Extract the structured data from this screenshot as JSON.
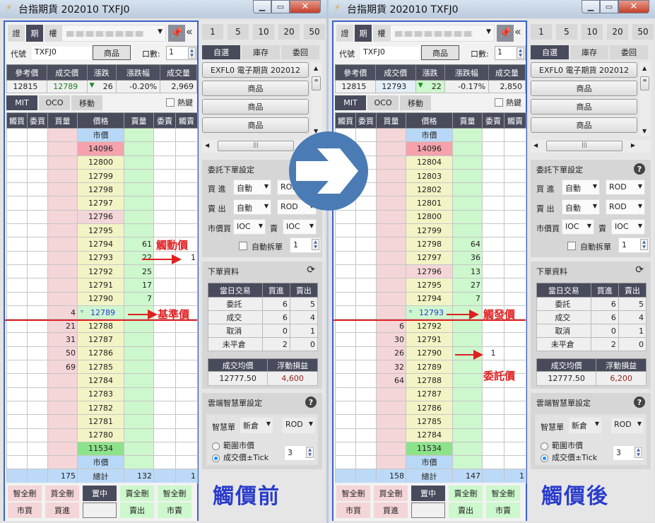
{
  "windows": {
    "before": {
      "title": "台指期貨 202010 TXFJ0",
      "segments": [
        "證",
        "期",
        "權"
      ],
      "active_segment": "期",
      "code_label": "代號",
      "code_value": "TXFJ0",
      "product_button": "商品",
      "qty_label": "口數:",
      "qty_value": "1",
      "quote_headers": [
        "參考價",
        "成交價",
        "漲跌",
        "漲跌幅",
        "成交量"
      ],
      "quote_values": {
        "ref": "12815",
        "last": "12789",
        "change": "26",
        "change_pct": "-0.20%",
        "volume": "2,969"
      },
      "tabs": [
        "MIT",
        "OCO",
        "移動"
      ],
      "hotkey_label": "熱鍵",
      "ladder_headers": [
        "觸買",
        "委買",
        "買量",
        "價格",
        "賣量",
        "委賣",
        "觸賣"
      ],
      "ladder_rows": [
        {
          "bq": "",
          "px": "市價",
          "sq": "",
          "ss": "",
          "ts": "",
          "kind": "mkt"
        },
        {
          "bq": "",
          "px": "14096",
          "sq": "",
          "ss": "",
          "ts": "",
          "kind": "up"
        },
        {
          "bq": "",
          "px": "12800",
          "sq": "",
          "ss": "",
          "ts": "",
          "kind": ""
        },
        {
          "bq": "",
          "px": "12799",
          "sq": "",
          "ss": "",
          "ts": "",
          "kind": ""
        },
        {
          "bq": "",
          "px": "12798",
          "sq": "",
          "ss": "",
          "ts": "",
          "kind": ""
        },
        {
          "bq": "",
          "px": "12797",
          "sq": "",
          "ss": "",
          "ts": "",
          "kind": ""
        },
        {
          "bq": "",
          "px": "12796",
          "sq": "",
          "ss": "",
          "ts": "",
          "kind": "pink"
        },
        {
          "bq": "",
          "px": "12795",
          "sq": "",
          "ss": "",
          "ts": "",
          "kind": ""
        },
        {
          "bq": "",
          "px": "12794",
          "sq": "61",
          "ss": "",
          "ts": "",
          "kind": ""
        },
        {
          "bq": "",
          "px": "12793",
          "sq": "22",
          "ss": "",
          "ts": "1",
          "kind": ""
        },
        {
          "bq": "",
          "px": "12792",
          "sq": "25",
          "ss": "",
          "ts": "",
          "kind": ""
        },
        {
          "bq": "",
          "px": "12791",
          "sq": "17",
          "ss": "",
          "ts": "",
          "kind": ""
        },
        {
          "bq": "",
          "px": "12790",
          "sq": "7",
          "ss": "",
          "ts": "",
          "kind": ""
        },
        {
          "bq": "4",
          "px": "12789",
          "sq": "",
          "ss": "",
          "ts": "",
          "kind": "cur"
        },
        {
          "bq": "21",
          "px": "12788",
          "sq": "",
          "ss": "",
          "ts": "",
          "kind": ""
        },
        {
          "bq": "31",
          "px": "12787",
          "sq": "",
          "ss": "",
          "ts": "",
          "kind": ""
        },
        {
          "bq": "50",
          "px": "12786",
          "sq": "",
          "ss": "",
          "ts": "",
          "kind": ""
        },
        {
          "bq": "69",
          "px": "12785",
          "sq": "",
          "ss": "",
          "ts": "",
          "kind": ""
        },
        {
          "bq": "",
          "px": "12784",
          "sq": "",
          "ss": "",
          "ts": "",
          "kind": ""
        },
        {
          "bq": "",
          "px": "12783",
          "sq": "",
          "ss": "",
          "ts": "",
          "kind": ""
        },
        {
          "bq": "",
          "px": "12782",
          "sq": "",
          "ss": "",
          "ts": "",
          "kind": ""
        },
        {
          "bq": "",
          "px": "12781",
          "sq": "",
          "ss": "",
          "ts": "",
          "kind": ""
        },
        {
          "bq": "",
          "px": "12780",
          "sq": "",
          "ss": "",
          "ts": "",
          "kind": ""
        },
        {
          "bq": "",
          "px": "11534",
          "sq": "",
          "ss": "",
          "ts": "",
          "kind": "dn"
        },
        {
          "bq": "",
          "px": "市價",
          "sq": "",
          "ss": "",
          "ts": "",
          "kind": "mkt"
        }
      ],
      "totals": {
        "bq": "175",
        "label": "總計",
        "sq": "132",
        "ts": "1"
      },
      "bottom_buttons": {
        "row1": [
          "智全刪",
          "買全刪",
          "置中",
          "賣全刪",
          "智全刪"
        ],
        "row2": [
          "市買",
          "買進",
          "",
          "賣出",
          "市賣"
        ]
      },
      "annotations": {
        "a1": "觸動價",
        "a2": "基準價"
      },
      "big_label": "觸價前",
      "qty_buttons": [
        "1",
        "5",
        "10",
        "20",
        "50"
      ],
      "right_tabs": [
        "自選",
        "庫存",
        "委回"
      ],
      "fav_items": [
        "EXFL0 電子期貨 202012",
        "商品",
        "商品",
        "商品"
      ],
      "order_settings": {
        "title": "委託下單設定",
        "buy_label": "買 進",
        "buy_type": "自動",
        "buy_tif": "ROD",
        "sell_label": "賣 出",
        "sell_type": "自動",
        "sell_tif": "ROD",
        "mkt_buy_label": "市價買",
        "mkt_buy_tif": "IOC",
        "mkt_sell_label": "賣",
        "mkt_sell_tif": "IOC",
        "auto_split_label": "自動拆單",
        "auto_split_value": "1"
      },
      "order_data": {
        "title": "下單資料",
        "headers": [
          "當日交易",
          "買進",
          "賣出"
        ],
        "rows": [
          [
            "委託",
            "6",
            "5"
          ],
          [
            "成交",
            "6",
            "4"
          ],
          [
            "取消",
            "0",
            "1"
          ],
          [
            "未平倉",
            "2",
            "0"
          ]
        ],
        "avg_label": "成交均價",
        "pnl_label": "浮動損益",
        "avg_value": "12777.50",
        "pnl_value": "4,600"
      },
      "smart_settings": {
        "title": "雲端智慧單設定",
        "smart_label": "智慧單",
        "smart_type": "新倉",
        "smart_tif": "ROD",
        "radio1": "範圍市價",
        "radio2": "成交價±Tick",
        "tick_value": "3"
      }
    },
    "after": {
      "title": "台指期貨 202010 TXFJ0",
      "segments": [
        "證",
        "期",
        "權"
      ],
      "active_segment": "期",
      "code_label": "代號",
      "code_value": "TXFJ0",
      "product_button": "商品",
      "qty_label": "口數:",
      "qty_value": "1",
      "quote_headers": [
        "參考價",
        "成交價",
        "漲跌",
        "漲跌幅",
        "成交量"
      ],
      "quote_values": {
        "ref": "12815",
        "last": "12793",
        "change": "22",
        "change_pct": "-0.17%",
        "volume": "2,850"
      },
      "tabs": [
        "MIT",
        "OCO",
        "移動"
      ],
      "hotkey_label": "熱鍵",
      "ladder_headers": [
        "觸買",
        "委買",
        "買量",
        "價格",
        "賣量",
        "委賣",
        "觸賣"
      ],
      "ladder_rows": [
        {
          "bq": "",
          "px": "市價",
          "sq": "",
          "ss": "",
          "ts": "",
          "kind": "mkt"
        },
        {
          "bq": "",
          "px": "14096",
          "sq": "",
          "ss": "",
          "ts": "",
          "kind": "up"
        },
        {
          "bq": "",
          "px": "12804",
          "sq": "",
          "ss": "",
          "ts": "",
          "kind": ""
        },
        {
          "bq": "",
          "px": "12803",
          "sq": "",
          "ss": "",
          "ts": "",
          "kind": ""
        },
        {
          "bq": "",
          "px": "12802",
          "sq": "",
          "ss": "",
          "ts": "",
          "kind": ""
        },
        {
          "bq": "",
          "px": "12801",
          "sq": "",
          "ss": "",
          "ts": "",
          "kind": ""
        },
        {
          "bq": "",
          "px": "12800",
          "sq": "",
          "ss": "",
          "ts": "",
          "kind": ""
        },
        {
          "bq": "",
          "px": "12799",
          "sq": "",
          "ss": "",
          "ts": "",
          "kind": ""
        },
        {
          "bq": "",
          "px": "12798",
          "sq": "64",
          "ss": "",
          "ts": "",
          "kind": ""
        },
        {
          "bq": "",
          "px": "12797",
          "sq": "36",
          "ss": "",
          "ts": "",
          "kind": ""
        },
        {
          "bq": "",
          "px": "12796",
          "sq": "13",
          "ss": "",
          "ts": "",
          "kind": "pink"
        },
        {
          "bq": "",
          "px": "12795",
          "sq": "27",
          "ss": "",
          "ts": "",
          "kind": ""
        },
        {
          "bq": "",
          "px": "12794",
          "sq": "7",
          "ss": "",
          "ts": "",
          "kind": ""
        },
        {
          "bq": "",
          "px": "12793",
          "sq": "",
          "ss": "",
          "ts": "",
          "kind": "cur"
        },
        {
          "bq": "6",
          "px": "12792",
          "sq": "",
          "ss": "",
          "ts": "",
          "kind": ""
        },
        {
          "bq": "30",
          "px": "12791",
          "sq": "",
          "ss": "",
          "ts": "",
          "kind": ""
        },
        {
          "bq": "26",
          "px": "12790",
          "sq": "",
          "ss": "1",
          "ts": "",
          "kind": ""
        },
        {
          "bq": "32",
          "px": "12789",
          "sq": "",
          "ss": "",
          "ts": "",
          "kind": ""
        },
        {
          "bq": "64",
          "px": "12788",
          "sq": "",
          "ss": "",
          "ts": "",
          "kind": ""
        },
        {
          "bq": "",
          "px": "12787",
          "sq": "",
          "ss": "",
          "ts": "",
          "kind": ""
        },
        {
          "bq": "",
          "px": "12786",
          "sq": "",
          "ss": "",
          "ts": "",
          "kind": ""
        },
        {
          "bq": "",
          "px": "12785",
          "sq": "",
          "ss": "",
          "ts": "",
          "kind": ""
        },
        {
          "bq": "",
          "px": "12784",
          "sq": "",
          "ss": "",
          "ts": "",
          "kind": ""
        },
        {
          "bq": "",
          "px": "11534",
          "sq": "",
          "ss": "",
          "ts": "",
          "kind": "dn"
        },
        {
          "bq": "",
          "px": "市價",
          "sq": "",
          "ss": "",
          "ts": "",
          "kind": "mkt"
        }
      ],
      "totals": {
        "bq": "158",
        "label": "總計",
        "sq": "147",
        "ts": "1"
      },
      "bottom_buttons": {
        "row1": [
          "智全刪",
          "買全刪",
          "置中",
          "賣全刪",
          "智全刪"
        ],
        "row2": [
          "市買",
          "買進",
          "",
          "賣出",
          "市賣"
        ]
      },
      "annotations": {
        "a1": "觸發價",
        "a2": "委託價"
      },
      "big_label": "觸價後",
      "qty_buttons": [
        "1",
        "5",
        "10",
        "20",
        "50"
      ],
      "right_tabs": [
        "自選",
        "庫存",
        "委回"
      ],
      "fav_items": [
        "EXFL0 電子期貨 202012",
        "商品",
        "商品",
        "商品"
      ],
      "order_settings": {
        "title": "委託下單設定",
        "buy_label": "買 進",
        "buy_type": "自動",
        "buy_tif": "ROD",
        "sell_label": "賣 出",
        "sell_type": "自動",
        "sell_tif": "ROD",
        "mkt_buy_label": "市價買",
        "mkt_buy_tif": "IOC",
        "mkt_sell_label": "賣",
        "mkt_sell_tif": "IOC",
        "auto_split_label": "自動拆單",
        "auto_split_value": "1"
      },
      "order_data": {
        "title": "下單資料",
        "headers": [
          "當日交易",
          "買進",
          "賣出"
        ],
        "rows": [
          [
            "委託",
            "6",
            "5"
          ],
          [
            "成交",
            "6",
            "4"
          ],
          [
            "取消",
            "0",
            "1"
          ],
          [
            "未平倉",
            "2",
            "0"
          ]
        ],
        "avg_label": "成交均價",
        "pnl_label": "浮動損益",
        "avg_value": "12777.50",
        "pnl_value": "6,200"
      },
      "smart_settings": {
        "title": "雲端智慧單設定",
        "smart_label": "智慧單",
        "smart_type": "新倉",
        "smart_tif": "ROD",
        "radio1": "範圍市價",
        "radio2": "成交價±Tick",
        "tick_value": "3"
      }
    }
  },
  "colors": {
    "accent_blue": "#3a62c8",
    "annotation_red": "#e02020",
    "header_dark": "#474b5c",
    "bid_pink": "#f4d5d8",
    "ask_green": "#cdf7cd",
    "price_yellow": "#f2f4c5"
  }
}
